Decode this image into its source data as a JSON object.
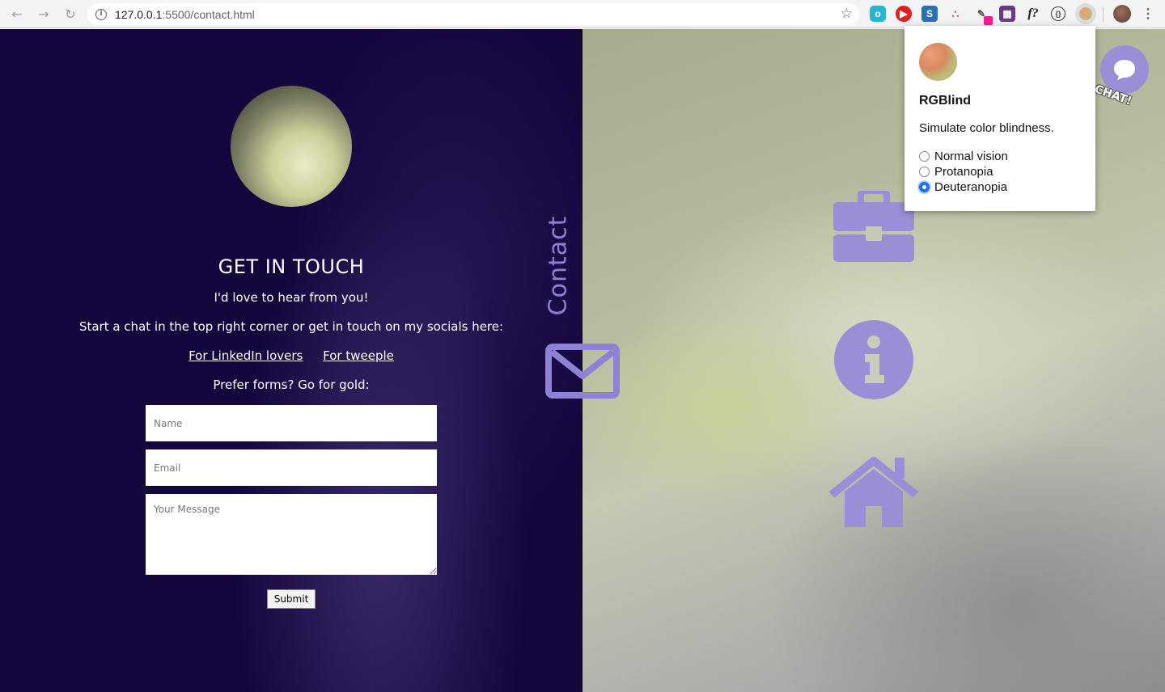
{
  "browser": {
    "url_host": "127.0.0.1",
    "url_path": ":5500/contact.html",
    "extensions": [
      "tampermonkey-icon",
      "ublock-icon",
      "s-icon",
      "asana-icon",
      "eyedropper-icon",
      "image-icon",
      "whatfont-icon",
      "bracket-icon",
      "rgblind-icon"
    ],
    "extension_badge_color": "#ff1a8c"
  },
  "page": {
    "title": "GET IN TOUCH",
    "subtitle": "I'd love to hear from you!",
    "chat_text": "Start a chat in the top right corner or get in touch on my socials here:",
    "links": [
      "For LinkedIn lovers",
      "For tweeple"
    ],
    "forms_text": "Prefer forms? Go for gold:",
    "placeholders": {
      "name": "Name",
      "email": "Email",
      "message": "Your Message"
    },
    "submit": "Submit",
    "vertical_label": "Contact",
    "accent_color": "#8e82d6",
    "left_bg": "#14063d"
  },
  "popup": {
    "title": "RGBlind",
    "description": "Simulate color blindness.",
    "options": [
      "Normal vision",
      "Protanopia",
      "Deuteranopia"
    ],
    "selected": "Deuteranopia"
  },
  "chat_widget": {
    "word": "CHAT!"
  }
}
